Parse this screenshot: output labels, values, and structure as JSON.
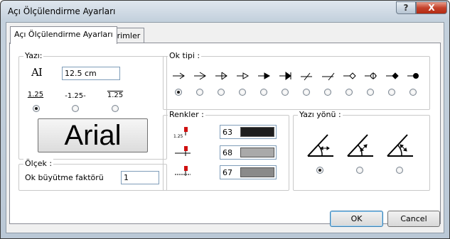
{
  "window": {
    "title": "Açı Ölçülendirme Ayarları",
    "help_glyph": "?",
    "close_glyph": "X"
  },
  "tabs": [
    {
      "label": "Açı Ölçülendirme Ayarları",
      "active": true
    },
    {
      "label": "Birimler",
      "active": false
    }
  ],
  "yazi": {
    "title": "Yazı:",
    "height_icon_glyph": "AI",
    "height_value": "12.5 cm",
    "samples": [
      "1.25",
      "-1.25-",
      "1.25"
    ],
    "selected_sample": 0,
    "font_preview": "Arial"
  },
  "olcek": {
    "title": "Ölçek :",
    "factor_label": "Ok büyütme faktörü",
    "factor_value": "1"
  },
  "ok_tipi": {
    "title": "Ok tipi :",
    "arrows": [
      "open-arrow-icon",
      "open-arrow-2-icon",
      "tee-arrow-icon",
      "hollow-triangle-arrow-icon",
      "filled-arrow-icon",
      "filled-tee-arrow-icon",
      "slash-arrow-icon",
      "slash-2-arrow-icon",
      "hollow-diamond-arrow-icon",
      "crosshair-circle-arrow-icon",
      "filled-diamond-arrow-icon",
      "filled-dot-arrow-icon"
    ],
    "selected": 0
  },
  "renkler": {
    "title": "Renkler :",
    "items": [
      {
        "icon": "text-color-icon",
        "icon_text": "1.25",
        "value": "63",
        "color": "#1e1e1e"
      },
      {
        "icon": "line-color-icon",
        "value": "68",
        "color": "#a9a9a9"
      },
      {
        "icon": "arrow-color-icon",
        "value": "67",
        "color": "#8a8a8a"
      }
    ]
  },
  "yazi_yonu": {
    "title": "Yazı yönü :",
    "options": [
      "horizontal-direction-icon",
      "aligned-direction-icon",
      "perpendicular-direction-icon"
    ],
    "selected": 0
  },
  "buttons": {
    "ok": "OK",
    "cancel": "Cancel"
  }
}
